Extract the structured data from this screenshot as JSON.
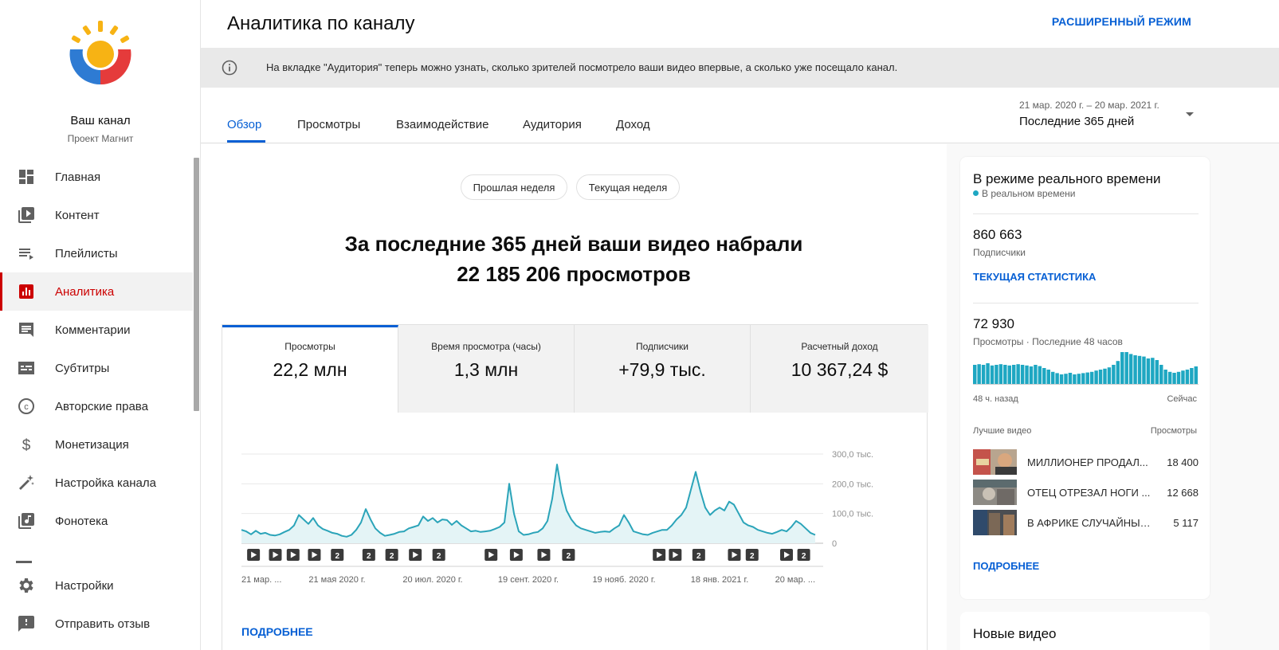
{
  "sidebar": {
    "channel_name": "Ваш канал",
    "channel_sub": "Проект Магнит",
    "items": [
      {
        "label": "Главная",
        "icon": "dashboard-icon"
      },
      {
        "label": "Контент",
        "icon": "video-library-icon"
      },
      {
        "label": "Плейлисты",
        "icon": "playlist-icon"
      },
      {
        "label": "Аналитика",
        "icon": "analytics-icon",
        "active": true
      },
      {
        "label": "Комментарии",
        "icon": "comment-icon"
      },
      {
        "label": "Субтитры",
        "icon": "subtitles-icon"
      },
      {
        "label": "Авторские права",
        "icon": "copyright-icon"
      },
      {
        "label": "Монетизация",
        "icon": "dollar-icon"
      },
      {
        "label": "Настройка канала",
        "icon": "magic-wand-icon"
      },
      {
        "label": "Фонотека",
        "icon": "audio-library-icon"
      },
      {
        "label": "Настройки",
        "icon": "gear-icon"
      },
      {
        "label": "Отправить отзыв",
        "icon": "feedback-icon"
      }
    ]
  },
  "header": {
    "title": "Аналитика по каналу",
    "advanced_mode": "РАСШИРЕННЫЙ РЕЖИМ"
  },
  "banner": {
    "text": "На вкладке \"Аудитория\" теперь можно узнать, сколько зрителей посмотрело ваши видео впервые, а сколько уже посещало канал."
  },
  "tabs": [
    "Обзор",
    "Просмотры",
    "Взаимодействие",
    "Аудитория",
    "Доход"
  ],
  "date": {
    "range": "21 мар. 2020 г. – 20 мар. 2021 г.",
    "label": "Последние 365 дней"
  },
  "main": {
    "pills": [
      "Прошлая неделя",
      "Текущая неделя"
    ],
    "headline_1": "За последние 365 дней ваши видео набрали",
    "headline_2": "22 185 206 просмотров",
    "metrics": [
      {
        "title": "Просмотры",
        "value": "22,2 млн"
      },
      {
        "title": "Время просмотра (часы)",
        "value": "1,3 млн"
      },
      {
        "title": "Подписчики",
        "value": "+79,9 тыс."
      },
      {
        "title": "Расчетный доход",
        "value": "10 367,24 $"
      }
    ],
    "more": "ПОДРОБНЕЕ"
  },
  "chart_data": {
    "type": "area",
    "ylim": [
      0,
      300000
    ],
    "yticks": [
      "300,0 тыс.",
      "200,0 тыс.",
      "100,0 тыс.",
      "0"
    ],
    "xticks": [
      "21 мар. ...",
      "21 мая 2020 г.",
      "20 июл. 2020 г.",
      "19 сент. 2020 г.",
      "19 нояб. 2020 г.",
      "18 янв. 2021 г.",
      "20 мар. ..."
    ],
    "values": [
      45000,
      40000,
      30000,
      42000,
      32000,
      35000,
      28000,
      26000,
      30000,
      38000,
      45000,
      60000,
      95000,
      80000,
      65000,
      85000,
      60000,
      48000,
      42000,
      35000,
      32000,
      25000,
      22000,
      28000,
      45000,
      70000,
      115000,
      80000,
      50000,
      35000,
      25000,
      28000,
      32000,
      38000,
      40000,
      50000,
      55000,
      60000,
      90000,
      75000,
      85000,
      70000,
      80000,
      78000,
      62000,
      75000,
      60000,
      50000,
      40000,
      42000,
      38000,
      40000,
      42000,
      48000,
      55000,
      70000,
      200000,
      100000,
      40000,
      28000,
      30000,
      35000,
      38000,
      50000,
      75000,
      150000,
      265000,
      170000,
      110000,
      80000,
      60000,
      50000,
      45000,
      40000,
      35000,
      38000,
      40000,
      38000,
      50000,
      60000,
      95000,
      70000,
      40000,
      35000,
      30000,
      28000,
      35000,
      40000,
      45000,
      45000,
      60000,
      80000,
      95000,
      120000,
      180000,
      240000,
      175000,
      120000,
      95000,
      110000,
      120000,
      110000,
      140000,
      130000,
      100000,
      70000,
      60000,
      55000,
      45000,
      40000,
      35000,
      32000,
      38000,
      45000,
      40000,
      55000,
      75000,
      65000,
      50000,
      35000,
      28000
    ],
    "video_markers": [
      {
        "frac": 0.021,
        "kind": "play"
      },
      {
        "frac": 0.059,
        "kind": "play"
      },
      {
        "frac": 0.09,
        "kind": "play"
      },
      {
        "frac": 0.127,
        "kind": "play"
      },
      {
        "frac": 0.167,
        "kind": "2"
      },
      {
        "frac": 0.222,
        "kind": "2"
      },
      {
        "frac": 0.262,
        "kind": "2"
      },
      {
        "frac": 0.303,
        "kind": "play"
      },
      {
        "frac": 0.344,
        "kind": "2"
      },
      {
        "frac": 0.435,
        "kind": "play"
      },
      {
        "frac": 0.479,
        "kind": "play"
      },
      {
        "frac": 0.527,
        "kind": "play"
      },
      {
        "frac": 0.57,
        "kind": "2"
      },
      {
        "frac": 0.728,
        "kind": "play"
      },
      {
        "frac": 0.756,
        "kind": "play"
      },
      {
        "frac": 0.797,
        "kind": "2"
      },
      {
        "frac": 0.859,
        "kind": "play"
      },
      {
        "frac": 0.89,
        "kind": "2"
      },
      {
        "frac": 0.95,
        "kind": "play"
      },
      {
        "frac": 0.98,
        "kind": "2"
      }
    ],
    "colors": {
      "line": "#2ba4b9",
      "fill": "#e4f4f6"
    }
  },
  "realtime": {
    "title": "В режиме реального времени",
    "sub": "В реальном времени",
    "subscribers": "860 663",
    "subscribers_label": "Подписчики",
    "current_stats": "ТЕКУЩАЯ СТАТИСТИКА",
    "views": "72 930",
    "views_label": "Просмотры · Последние 48 часов",
    "bars": [
      0.6,
      0.62,
      0.6,
      0.65,
      0.58,
      0.6,
      0.62,
      0.6,
      0.58,
      0.6,
      0.62,
      0.6,
      0.58,
      0.55,
      0.6,
      0.56,
      0.5,
      0.45,
      0.38,
      0.34,
      0.3,
      0.32,
      0.35,
      0.3,
      0.32,
      0.34,
      0.36,
      0.38,
      0.42,
      0.45,
      0.48,
      0.52,
      0.6,
      0.72,
      1.0,
      1.0,
      0.94,
      0.9,
      0.88,
      0.86,
      0.8,
      0.82,
      0.75,
      0.6,
      0.45,
      0.38,
      0.35,
      0.38,
      0.42,
      0.45,
      0.5,
      0.55
    ],
    "bar_color": "#1ea7c2",
    "from_label": "48 ч. назад",
    "to_label": "Сейчас",
    "top_videos": "Лучшие видео",
    "views_header": "Просмотры",
    "videos": [
      {
        "title": "МИЛЛИОНЕР ПРОДАЛ...",
        "views": "18 400"
      },
      {
        "title": "ОТЕЦ ОТРЕЗАЛ НОГИ ...",
        "views": "12 668"
      },
      {
        "title": "В АФРИКЕ СЛУЧАЙНЫЙ...",
        "views": "5 117"
      }
    ],
    "more": "ПОДРОБНЕЕ"
  },
  "new_videos": {
    "title": "Новые видео"
  }
}
